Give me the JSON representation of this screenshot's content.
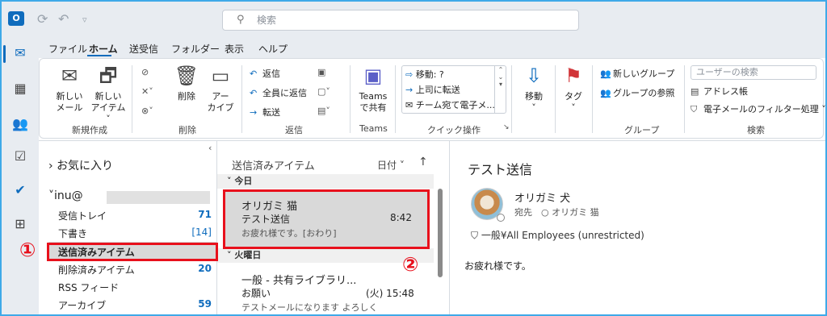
{
  "titlebar": {
    "search_placeholder": "検索",
    "app_logo": "O"
  },
  "tabs": [
    "ファイル",
    "ホーム",
    "送受信",
    "フォルダー",
    "表示",
    "ヘルプ"
  ],
  "ribbon": {
    "new_mail": "新しい\nメール",
    "new_mail_l1": "新しい",
    "new_mail_l2": "メール",
    "new_item_l1": "新しい",
    "new_item_l2": "アイテム ˅",
    "group_new": "新規作成",
    "delete": "削除",
    "archive_l1": "アー",
    "archive_l2": "カイブ",
    "group_delete": "削除",
    "reply": "返信",
    "reply_all": "全員に返信",
    "forward": "転送",
    "group_respond": "返信",
    "teams_l1": "Teams",
    "teams_l2": "で共有",
    "group_teams": "Teams",
    "quick_steps": [
      "移動: ?",
      "上司に転送",
      "チーム宛て電子メ..."
    ],
    "group_quick": "クイック操作",
    "move": "移動",
    "tag": "タグ",
    "new_group": "新しいグループ",
    "browse_group": "グループの参照",
    "group_groups": "グループ",
    "user_search_placeholder": "ユーザーの検索",
    "address_book": "アドレス帳",
    "filter_mail": "電子メールのフィルター処理 ˅",
    "group_find": "検索"
  },
  "folders": {
    "favorites": "お気に入り",
    "account": "inu@",
    "items": [
      {
        "label": "受信トレイ",
        "count": "71"
      },
      {
        "label": "下書き",
        "count": "[14]"
      },
      {
        "label": "送信済みアイテム",
        "count": ""
      },
      {
        "label": "削除済みアイテム",
        "count": "20"
      },
      {
        "label": "RSS フィード",
        "count": ""
      },
      {
        "label": "アーカイブ",
        "count": "59"
      }
    ]
  },
  "messages": {
    "folder_title": "送信済みアイテム",
    "sort_label": "日付 ˅",
    "group_today": "今日",
    "group_tuesday": "火曜日",
    "msg1": {
      "to": "オリガミ 猫",
      "subject": "テスト送信",
      "time": "8:42",
      "preview": "お疲れ様です。[おわり]"
    },
    "msg2": {
      "to": "一般 - 共有ライブラリ...",
      "subject": "お願い",
      "time": "(火) 15:48",
      "preview": "テストメールになります よろしく"
    }
  },
  "reader": {
    "subject": "テスト送信",
    "sender": "オリガミ 犬",
    "to_label": "宛先",
    "to_name": "オリガミ 猫",
    "sensitivity": "一般¥All Employees (unrestricted)",
    "body": "お疲れ様です。"
  },
  "annotations": {
    "marker1": "①",
    "marker2": "②"
  },
  "colors": {
    "accent": "#0f6cbd",
    "highlight_box": "#e8101c",
    "frame": "#3fa9e8"
  }
}
